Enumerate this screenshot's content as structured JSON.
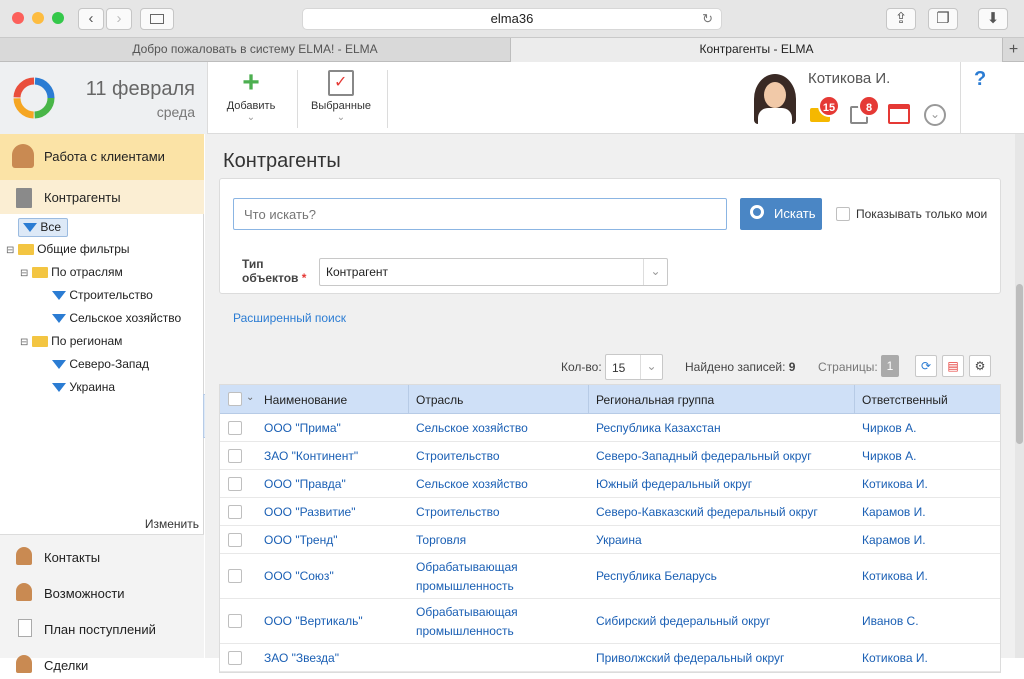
{
  "browser": {
    "url": "elma36",
    "tabs": [
      {
        "label": "Добро пожаловать в систему ELMA! - ELMA"
      },
      {
        "label": "Контрагенты - ELMA"
      }
    ],
    "new_tab": "+"
  },
  "header": {
    "date": "11 февраля",
    "weekday": "среда",
    "add_label": "Добавить",
    "favorites_label": "Выбранные",
    "user_name": "Котикова И.",
    "help": "?",
    "badges": {
      "messages": "15",
      "tasks": "8"
    }
  },
  "sidebar": {
    "section_title": "Работа с клиентами",
    "active_item": "Контрагенты",
    "tree": {
      "all": "Все",
      "common_filters": "Общие фильтры",
      "by_industry": "По отраслям",
      "construction": "Строительство",
      "agriculture": "Сельское хозяйство",
      "by_region": "По регионам",
      "northwest": "Северо-Запад",
      "ukraine": "Украина"
    },
    "edit_link": "Изменить",
    "bottom_items": [
      {
        "label": "Контакты"
      },
      {
        "label": "Возможности"
      },
      {
        "label": "План поступлений"
      },
      {
        "label": "Сделки"
      }
    ]
  },
  "main": {
    "title": "Контрагенты",
    "search": {
      "placeholder": "Что искать?",
      "button": "Искать",
      "only_mine": "Показывать только мои",
      "type_label_1": "Тип",
      "type_label_2": "объектов",
      "required_mark": "*",
      "type_value": "Контрагент",
      "advanced": "Расширенный поиск"
    },
    "pager": {
      "count_label": "Кол-во:",
      "count_value": "15",
      "found_label": "Найдено записей:",
      "found_value": "9",
      "pages_label": "Страницы:",
      "page": "1"
    },
    "columns": [
      "Наименование",
      "Отрасль",
      "Региональная группа",
      "Ответственный"
    ],
    "rows": [
      {
        "name": "ООО \"Прима\"",
        "industry": "Сельское хозяйство",
        "region": "Республика Казахстан",
        "owner": "Чирков А."
      },
      {
        "name": "ЗАО \"Континент\"",
        "industry": "Строительство",
        "region": "Северо-Западный федеральный округ",
        "owner": "Чирков А."
      },
      {
        "name": "ООО \"Правда\"",
        "industry": "Сельское хозяйство",
        "region": "Южный федеральный округ",
        "owner": "Котикова И."
      },
      {
        "name": "ООО \"Развитие\"",
        "industry": "Строительство",
        "region": "Северо-Кавказский федеральный округ",
        "owner": "Карамов И."
      },
      {
        "name": "ООО \"Тренд\"",
        "industry": "Торговля",
        "region": "Украина",
        "owner": "Карамов И."
      },
      {
        "name": "ООО \"Союз\"",
        "industry_1": "Обрабатывающая",
        "industry_2": "промышленность",
        "region": "Республика Беларусь",
        "owner": "Котикова И."
      },
      {
        "name": "ООО \"Вертикаль\"",
        "industry_1": "Обрабатывающая",
        "industry_2": "промышленность",
        "region": "Сибирский федеральный округ",
        "owner": "Иванов С."
      },
      {
        "name": "ЗАО \"Звезда\"",
        "industry": "",
        "region": "Приволжский федеральный округ",
        "owner": "Котикова И."
      }
    ]
  },
  "colors": {
    "accent": "#2b7cd3",
    "section_bg": "#fbe3a6",
    "grid_header": "#cfe0f7",
    "search_btn": "#4a86c5"
  }
}
